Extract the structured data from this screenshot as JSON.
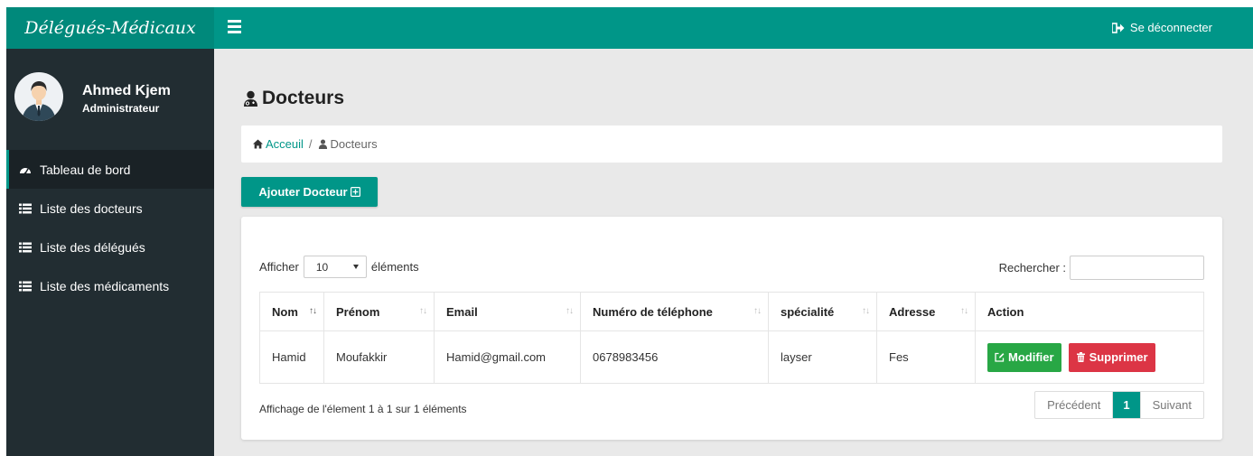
{
  "brand": {
    "title": "Délégués-Médicaux"
  },
  "topbar": {
    "logout_label": "Se déconnecter"
  },
  "user": {
    "name": "Ahmed Kjem",
    "role": "Administrateur"
  },
  "sidebar": {
    "items": [
      {
        "label": "Tableau de bord",
        "icon": "dashboard-icon",
        "active": true
      },
      {
        "label": "Liste des docteurs",
        "icon": "list-icon"
      },
      {
        "label": "Liste des délégués",
        "icon": "list-icon"
      },
      {
        "label": "Liste des médicaments",
        "icon": "list-icon"
      }
    ]
  },
  "page": {
    "title": "Docteurs",
    "title_icon": "user-md-icon"
  },
  "breadcrumb": {
    "home": "Acceuil",
    "separator": "/",
    "current": "Docteurs"
  },
  "actions": {
    "add_label": "Ajouter Docteur"
  },
  "table": {
    "length_prefix": "Afficher",
    "length_value": "10",
    "length_suffix": "éléments",
    "search_label": "Rechercher :",
    "search_value": "",
    "headers": [
      "Nom",
      "Prénom",
      "Email",
      "Numéro de téléphone",
      "spécialité",
      "Adresse",
      "Action"
    ],
    "rows": [
      {
        "nom": "Hamid",
        "prenom": "Moufakkir",
        "email": "Hamid@gmail.com",
        "telephone": "0678983456",
        "specialite": "layser",
        "adresse": "Fes"
      }
    ],
    "row_actions": {
      "edit": "Modifier",
      "delete": "Supprimer"
    },
    "info": "Affichage de l'élement 1 à 1 sur 1 éléments",
    "pagination": {
      "prev": "Précédent",
      "current": "1",
      "next": "Suivant"
    }
  },
  "colors": {
    "primary": "#009688",
    "brand_bg": "#00897b",
    "sidebar": "#222d32",
    "success": "#28a745",
    "danger": "#dc3545"
  }
}
